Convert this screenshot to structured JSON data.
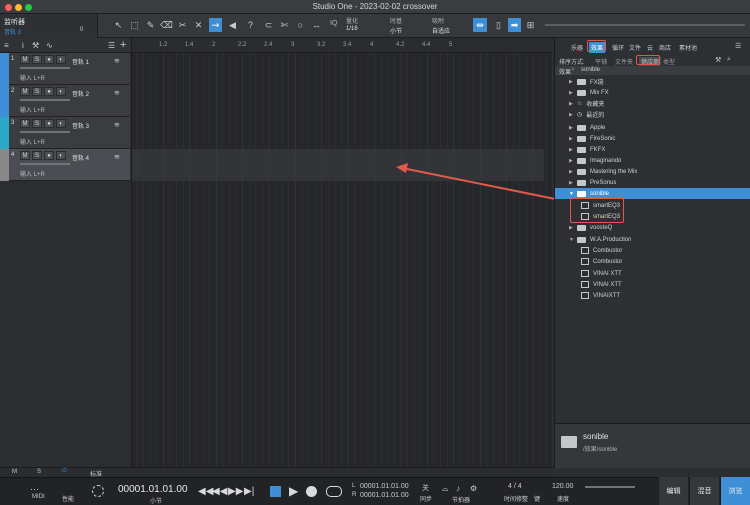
{
  "window": {
    "title": "Studio One - 2023-02-02 crossover"
  },
  "toolbar": {
    "monitor_title": "监听器",
    "monitor_sub": "音轨 3",
    "monitor_value": "0",
    "quantize_label": "量化",
    "quantize_value": "1/16",
    "timebase_label": "时基",
    "timebase_value": "小节",
    "snap_label": "吸附",
    "snap_value": "自适应",
    "iq_label": "IQ"
  },
  "ruler": {
    "ticks": [
      "1.2",
      "1.4",
      "2",
      "2.2",
      "2.4",
      "3",
      "3.2",
      "3.4",
      "4",
      "4.2",
      "4.4",
      "5"
    ]
  },
  "tracks": [
    {
      "num": "1",
      "name": "音轨 1",
      "input": "输入 L+R",
      "color": "#3d8fd8"
    },
    {
      "num": "2",
      "name": "音轨 2",
      "input": "输入 L+R",
      "color": "#3d8fd8"
    },
    {
      "num": "3",
      "name": "音轨 3",
      "input": "输入 L+R",
      "color": "#2aa8c9"
    },
    {
      "num": "4",
      "name": "音轨 4",
      "input": "输入 L+R",
      "color": "#3d8fd8"
    }
  ],
  "track_buttons": {
    "m": "M",
    "s": "S"
  },
  "browser": {
    "tabs": [
      "乐器",
      "效果",
      "循环",
      "文件",
      "云",
      "商店",
      "素材池"
    ],
    "sort_label": "排序方式:",
    "sort_options": [
      "平铺",
      "文件夹",
      "供应商",
      "类型"
    ],
    "breadcrumb": [
      "效果",
      "sonible"
    ],
    "items": [
      {
        "label": "FX链",
        "kind": "folder",
        "indent": 0
      },
      {
        "label": "Mix FX",
        "kind": "folder",
        "indent": 0
      },
      {
        "label": "收藏夹",
        "kind": "star",
        "indent": 0
      },
      {
        "label": "最近的",
        "kind": "clock",
        "indent": 0
      },
      {
        "label": "Apple",
        "kind": "folder",
        "indent": 0
      },
      {
        "label": "FireSonic",
        "kind": "folder",
        "indent": 0
      },
      {
        "label": "FKFX",
        "kind": "folder",
        "indent": 0
      },
      {
        "label": "Imaginando",
        "kind": "folder",
        "indent": 0
      },
      {
        "label": "Mastering the Mix",
        "kind": "folder",
        "indent": 0
      },
      {
        "label": "PreSonus",
        "kind": "folder",
        "indent": 0
      },
      {
        "label": "sonible",
        "kind": "folder-open",
        "indent": 0
      },
      {
        "label": "smartEQ3",
        "kind": "plugin",
        "indent": 1
      },
      {
        "label": "smartEQ3",
        "kind": "plugin",
        "indent": 1
      },
      {
        "label": "voosteQ",
        "kind": "folder",
        "indent": 0
      },
      {
        "label": "W.A.Production",
        "kind": "folder-open",
        "indent": 0
      },
      {
        "label": "Combustor",
        "kind": "plugin",
        "indent": 1
      },
      {
        "label": "Combustor",
        "kind": "plugin",
        "indent": 1
      },
      {
        "label": "VINAI XTT",
        "kind": "plugin",
        "indent": 1
      },
      {
        "label": "VINAI XTT",
        "kind": "plugin",
        "indent": 1
      },
      {
        "label": "VINAIXTT",
        "kind": "plugin",
        "indent": 1
      }
    ],
    "info_title": "sonible",
    "info_path": "/效果/sonible"
  },
  "status": {
    "m": "M",
    "s": "S",
    "mode": "标准"
  },
  "transport": {
    "midi_label": "MIDI",
    "perf_label": "性能",
    "position": "00001.01.01.00",
    "position_unit": "小节",
    "loop_l": "00001.01.01.00",
    "loop_r": "00001.01.01.00",
    "l_label": "L",
    "r_label": "R",
    "sync_value": "关",
    "sync_label": "同步",
    "metronome_label": "节拍器",
    "signature": "4 / 4",
    "signature_label": "时间修整",
    "key_label": "键",
    "tempo": "120.00",
    "tempo_label": "速度"
  },
  "nav": {
    "edit": "编辑",
    "mix": "混音",
    "browse": "浏览"
  },
  "colors": {
    "accent": "#3f8fd6",
    "highlight": "#e05a4a",
    "track_blue": "#3d8fd8"
  }
}
